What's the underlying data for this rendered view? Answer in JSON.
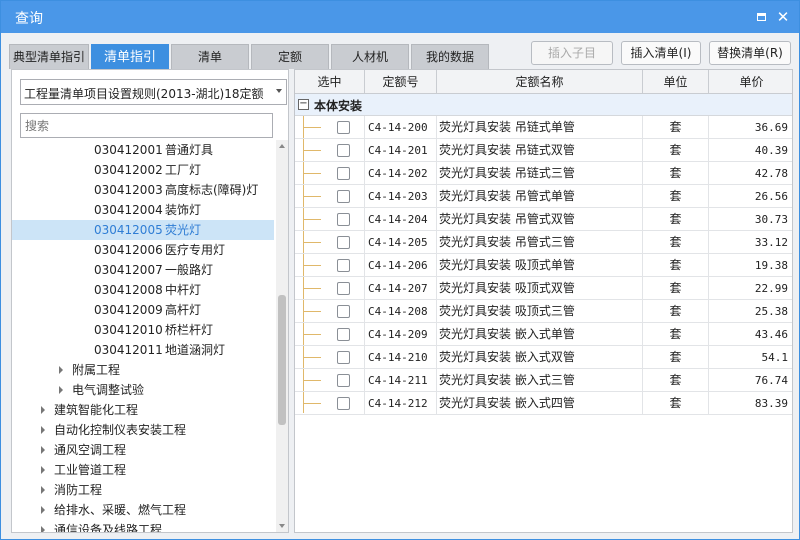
{
  "window": {
    "title": "查询"
  },
  "tabs": [
    "典型清单指引",
    "清单指引",
    "清单",
    "定额",
    "人材机",
    "我的数据"
  ],
  "buttons": {
    "insert_child": "插入子目",
    "insert_list": "插入清单(I)",
    "replace_list": "替换清单(R)"
  },
  "left": {
    "combo_value": "工程量清单项目设置规则(2013-湖北)18定额",
    "search_placeholder": "搜索",
    "tree": [
      {
        "code": "030412001",
        "name": "普通灯具",
        "level": 3
      },
      {
        "code": "030412002",
        "name": "工厂灯",
        "level": 3
      },
      {
        "code": "030412003",
        "name": "高度标志(障碍)灯",
        "level": 3
      },
      {
        "code": "030412004",
        "name": "装饰灯",
        "level": 3
      },
      {
        "code": "030412005",
        "name": "荧光灯",
        "level": 3,
        "selected": true
      },
      {
        "code": "030412006",
        "name": "医疗专用灯",
        "level": 3
      },
      {
        "code": "030412007",
        "name": "一般路灯",
        "level": 3
      },
      {
        "code": "030412008",
        "name": "中杆灯",
        "level": 3
      },
      {
        "code": "030412009",
        "name": "高杆灯",
        "level": 3
      },
      {
        "code": "030412010",
        "name": "桥栏杆灯",
        "level": 3
      },
      {
        "code": "030412011",
        "name": "地道涵洞灯",
        "level": 3
      },
      {
        "code": "",
        "name": "附属工程",
        "level": 2
      },
      {
        "code": "",
        "name": "电气调整试验",
        "level": 2
      },
      {
        "code": "",
        "name": "建筑智能化工程",
        "level": 1
      },
      {
        "code": "",
        "name": "自动化控制仪表安装工程",
        "level": 1
      },
      {
        "code": "",
        "name": "通风空调工程",
        "level": 1
      },
      {
        "code": "",
        "name": "工业管道工程",
        "level": 1
      },
      {
        "code": "",
        "name": "消防工程",
        "level": 1
      },
      {
        "code": "",
        "name": "给排水、采暖、燃气工程",
        "level": 1
      },
      {
        "code": "",
        "name": "通信设备及线路工程",
        "level": 1
      }
    ]
  },
  "grid": {
    "headers": [
      "选中",
      "定额号",
      "定额名称",
      "单位",
      "单价"
    ],
    "group": "本体安装",
    "rows": [
      {
        "code": "C4-14-200",
        "name": "荧光灯具安装 吊链式单管",
        "unit": "套",
        "price": "36.69"
      },
      {
        "code": "C4-14-201",
        "name": "荧光灯具安装 吊链式双管",
        "unit": "套",
        "price": "40.39"
      },
      {
        "code": "C4-14-202",
        "name": "荧光灯具安装 吊链式三管",
        "unit": "套",
        "price": "42.78"
      },
      {
        "code": "C4-14-203",
        "name": "荧光灯具安装 吊管式单管",
        "unit": "套",
        "price": "26.56"
      },
      {
        "code": "C4-14-204",
        "name": "荧光灯具安装 吊管式双管",
        "unit": "套",
        "price": "30.73"
      },
      {
        "code": "C4-14-205",
        "name": "荧光灯具安装 吊管式三管",
        "unit": "套",
        "price": "33.12"
      },
      {
        "code": "C4-14-206",
        "name": "荧光灯具安装 吸顶式单管",
        "unit": "套",
        "price": "19.38"
      },
      {
        "code": "C4-14-207",
        "name": "荧光灯具安装 吸顶式双管",
        "unit": "套",
        "price": "22.99"
      },
      {
        "code": "C4-14-208",
        "name": "荧光灯具安装 吸顶式三管",
        "unit": "套",
        "price": "25.38"
      },
      {
        "code": "C4-14-209",
        "name": "荧光灯具安装 嵌入式单管",
        "unit": "套",
        "price": "43.46"
      },
      {
        "code": "C4-14-210",
        "name": "荧光灯具安装 嵌入式双管",
        "unit": "套",
        "price": "54.1"
      },
      {
        "code": "C4-14-211",
        "name": "荧光灯具安装 嵌入式三管",
        "unit": "套",
        "price": "76.74"
      },
      {
        "code": "C4-14-212",
        "name": "荧光灯具安装 嵌入式四管",
        "unit": "套",
        "price": "83.39"
      }
    ]
  }
}
